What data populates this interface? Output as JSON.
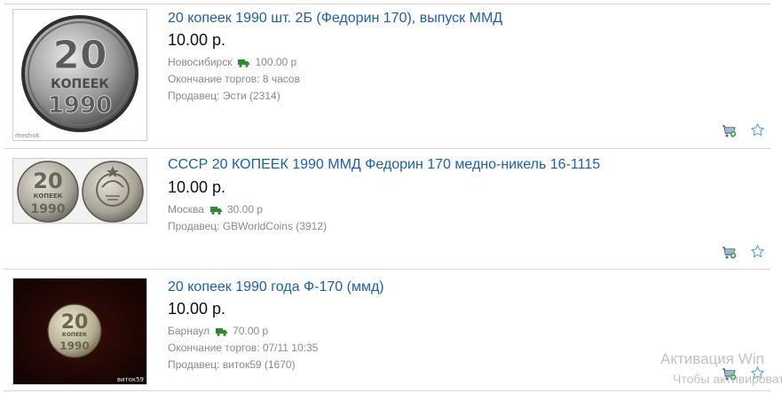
{
  "listings": [
    {
      "title": "20 копеек 1990 шт. 2Б (Федорин 170), выпуск ММД",
      "price": "10.00 р.",
      "city": "Новосибирск",
      "shipping": "100.00 р",
      "auction_end": "Окончание торгов: 8 часов",
      "seller": "Продавец: Эсти (2314)",
      "image_watermark": "meshok"
    },
    {
      "title": "СССР 20 КОПЕЕК 1990 ММД Федорин 170 медно-никель 16-1115",
      "price": "10.00 р.",
      "city": "Москва",
      "shipping": "30.00 р",
      "seller": "Продавец: GBWorldCoins (3912)"
    },
    {
      "title": "20 копеек 1990 года Ф-170 (ммд)",
      "price": "10.00 р.",
      "city": "Барнаул",
      "shipping": "70.00 р",
      "auction_end": "Окончание торгов: 07/11 10:35",
      "seller": "Продавец: виток59 (1670)",
      "image_watermark": "виток59"
    }
  ],
  "coin": {
    "denomination": "20",
    "word": "КОПЕЕК",
    "year": "1990"
  },
  "icons": {
    "shipping": "truck-icon",
    "add_cart": "add-to-cart-icon",
    "favorite": "star-outline-icon"
  },
  "colors": {
    "title_link": "#1a5fb4",
    "truck": "#2e8b2e",
    "star": "#5aa5d6",
    "meta_text": "#8a8a8a"
  },
  "os_watermark": {
    "line1": "Активация Win",
    "line2": "Чтобы активироват"
  }
}
